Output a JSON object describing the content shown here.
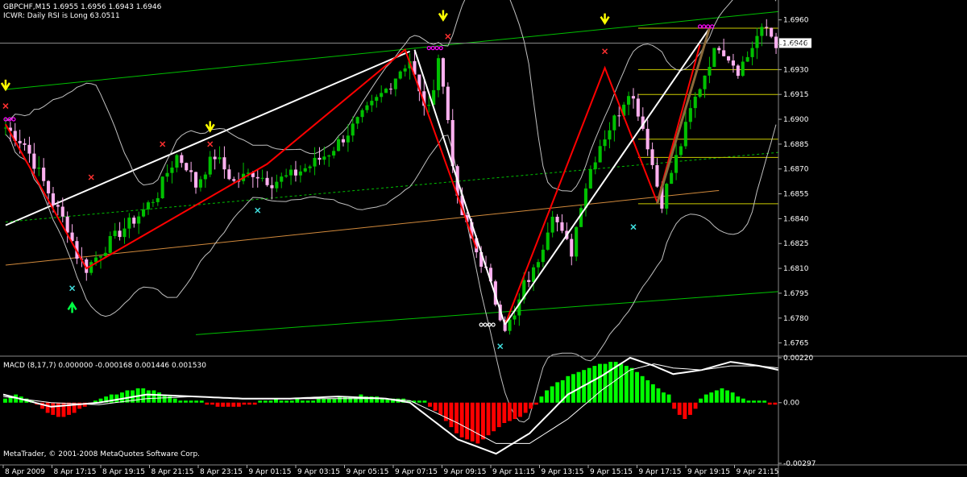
{
  "header": {
    "symbol_line": "GBPCHF,M15  1.6955 1.6956 1.6943 1.6946",
    "indicator_line": "ICWR: Daily RSI is Long 63.0511"
  },
  "macd": {
    "label": "MACD  (8,17,7) 0.000000 -0.000168 0.001446 0.001530"
  },
  "footer": {
    "copyright": "MetaTrader, © 2001-2008 MetaQuotes Software Corp."
  },
  "price_box": "1.6946",
  "colors": {
    "background": "#000000",
    "bull_candle": "#00c000",
    "bear_candle": "#ffb0f0",
    "zigzag": "#ff0000",
    "channel_white": "#ffffff",
    "channel_green": "#00c000",
    "ema": "#d28a3c",
    "fib": "#cccc00",
    "bollinger": "#c0c0c0",
    "macd_pos": "#00ff00",
    "macd_neg": "#ff0000"
  },
  "chart_data": [
    {
      "type": "candlestick",
      "symbol": "GBPCHF",
      "timeframe": "M15",
      "ylim": [
        1.6758,
        1.6972
      ],
      "yticks": [
        "1.6960",
        "1.6945",
        "1.6930",
        "1.6915",
        "1.6900",
        "1.6885",
        "1.6870",
        "1.6855",
        "1.6840",
        "1.6825",
        "1.6810",
        "1.6795",
        "1.6780",
        "1.6765"
      ],
      "xticks": [
        "8 Apr 2009",
        "8 Apr 17:15",
        "8 Apr 19:15",
        "8 Apr 21:15",
        "8 Apr 23:15",
        "9 Apr 01:15",
        "9 Apr 03:15",
        "9 Apr 05:15",
        "9 Apr 07:15",
        "9 Apr 09:15",
        "9 Apr 11:15",
        "9 Apr 13:15",
        "9 Apr 15:15",
        "9 Apr 17:15",
        "9 Apr 19:15",
        "9 Apr 21:15"
      ],
      "close_path": [
        [
          0,
          1.6895
        ],
        [
          4,
          1.6885
        ],
        [
          8,
          1.6862
        ],
        [
          10,
          1.685
        ],
        [
          13,
          1.6835
        ],
        [
          15,
          1.6818
        ],
        [
          17,
          1.681
        ],
        [
          20,
          1.682
        ],
        [
          24,
          1.6832
        ],
        [
          28,
          1.6842
        ],
        [
          32,
          1.6855
        ],
        [
          34,
          1.6868
        ],
        [
          36,
          1.6878
        ],
        [
          38,
          1.6872
        ],
        [
          40,
          1.686
        ],
        [
          42,
          1.687
        ],
        [
          44,
          1.6878
        ],
        [
          46,
          1.687
        ],
        [
          48,
          1.6862
        ],
        [
          52,
          1.6868
        ],
        [
          56,
          1.6862
        ],
        [
          60,
          1.6866
        ],
        [
          64,
          1.6872
        ],
        [
          68,
          1.688
        ],
        [
          72,
          1.6892
        ],
        [
          76,
          1.6905
        ],
        [
          80,
          1.6918
        ],
        [
          83,
          1.693
        ],
        [
          85,
          1.6936
        ],
        [
          87,
          1.6915
        ],
        [
          89,
          1.6905
        ],
        [
          91,
          1.6938
        ],
        [
          93,
          1.69
        ],
        [
          95,
          1.685
        ],
        [
          97,
          1.6835
        ],
        [
          99,
          1.682
        ],
        [
          101,
          1.6808
        ],
        [
          103,
          1.679
        ],
        [
          105,
          1.6775
        ],
        [
          107,
          1.678
        ],
        [
          109,
          1.68
        ],
        [
          111,
          1.6808
        ],
        [
          113,
          1.6825
        ],
        [
          115,
          1.6845
        ],
        [
          117,
          1.683
        ],
        [
          119,
          1.682
        ],
        [
          121,
          1.685
        ],
        [
          123,
          1.687
        ],
        [
          125,
          1.6885
        ],
        [
          127,
          1.6895
        ],
        [
          129,
          1.6905
        ],
        [
          131,
          1.6918
        ],
        [
          133,
          1.6905
        ],
        [
          135,
          1.6885
        ],
        [
          137,
          1.686
        ],
        [
          138,
          1.685
        ],
        [
          140,
          1.6868
        ],
        [
          142,
          1.6885
        ],
        [
          144,
          1.6905
        ],
        [
          146,
          1.692
        ],
        [
          148,
          1.6935
        ],
        [
          150,
          1.6945
        ],
        [
          152,
          1.6938
        ],
        [
          154,
          1.693
        ],
        [
          156,
          1.6938
        ],
        [
          158,
          1.695
        ],
        [
          160,
          1.6955
        ],
        [
          162,
          1.6946
        ]
      ],
      "zigzag": [
        [
          0,
          1.6895
        ],
        [
          17,
          1.681
        ],
        [
          55,
          1.687
        ],
        [
          83,
          1.6941
        ],
        [
          138,
          1.685
        ],
        [
          127,
          1.6931
        ]
      ],
      "annotations": [
        "buy arrow",
        "sell arrows",
        "swing markers"
      ]
    },
    {
      "type": "bar",
      "title": "MACD",
      "params": "(8,17,7)",
      "yticks": [
        "0.00220",
        "0.00",
        "-0.00297"
      ],
      "ylim": [
        -0.00297,
        0.0022
      ],
      "histogram": [
        0.0002,
        0.0003,
        0.0004,
        0.0003,
        0.0002,
        0.0001,
        -0.0001,
        -0.0003,
        -0.0005,
        -0.0006,
        -0.0007,
        -0.0007,
        -0.0006,
        -0.0005,
        -0.0003,
        -0.0002,
        -0.0001,
        0.0001,
        0.0002,
        0.0003,
        0.0004,
        0.0004,
        0.0005,
        0.0006,
        0.0006,
        0.0007,
        0.0007,
        0.0006,
        0.0006,
        0.0005,
        0.0004,
        0.0003,
        0.0002,
        0.0001,
        0.0001,
        0.0001,
        0.0001,
        0.0001,
        -0.0001,
        -0.0001,
        -0.0002,
        -0.0002,
        -0.0002,
        -0.0002,
        -0.0002,
        -0.0001,
        -0.0001,
        -0.0001,
        0.0001,
        0.0001,
        0.0001,
        0.0002,
        0.0001,
        0.0001,
        0.0001,
        0.0002,
        0.0001,
        0.0001,
        0.0001,
        0.0002,
        0.0002,
        0.0002,
        0.0002,
        0.0003,
        0.0003,
        0.0003,
        0.0003,
        0.0004,
        0.0003,
        0.0003,
        0.0003,
        0.0002,
        0.0002,
        0.0002,
        0.0002,
        0.0002,
        0.0001,
        0.0001,
        0.0001,
        0.0001,
        -0.0002,
        -0.0004,
        -0.0006,
        -0.0009,
        -0.0012,
        -0.0015,
        -0.0017,
        -0.0018,
        -0.0019,
        -0.002,
        -0.0018,
        -0.0016,
        -0.0014,
        -0.0012,
        -0.001,
        -0.0009,
        -0.0008,
        -0.0007,
        -0.0005,
        -0.0003,
        -0.0001,
        0.0003,
        0.0006,
        0.0008,
        0.001,
        0.0011,
        0.0013,
        0.0014,
        0.0015,
        0.0016,
        0.0017,
        0.0018,
        0.0019,
        0.0019,
        0.002,
        0.002,
        0.0019,
        0.0018,
        0.0017,
        0.0015,
        0.0013,
        0.0011,
        0.0009,
        0.0007,
        0.0005,
        0.0004,
        -0.0003,
        -0.0006,
        -0.0008,
        -0.0006,
        -0.0003,
        0.0002,
        0.0004,
        0.0005,
        0.0006,
        0.0007,
        0.0006,
        0.0005,
        0.0003,
        0.0002,
        0.0001,
        0.0001,
        0.0001,
        0.0001,
        -0.0001,
        -0.0001
      ],
      "macd_line_path": [
        [
          0,
          0.0004
        ],
        [
          10,
          -0.0002
        ],
        [
          20,
          0.0
        ],
        [
          30,
          0.0004
        ],
        [
          40,
          0.0003
        ],
        [
          50,
          0.0002
        ],
        [
          60,
          0.0002
        ],
        [
          70,
          0.0003
        ],
        [
          80,
          0.0002
        ],
        [
          85,
          0.0
        ],
        [
          95,
          -0.0018
        ],
        [
          103,
          -0.0025
        ],
        [
          110,
          -0.0015
        ],
        [
          118,
          0.0004
        ],
        [
          125,
          0.0013
        ],
        [
          131,
          0.0022
        ],
        [
          136,
          0.0018
        ],
        [
          140,
          0.0014
        ],
        [
          146,
          0.0016
        ],
        [
          152,
          0.002
        ],
        [
          158,
          0.0018
        ],
        [
          162,
          0.0016
        ]
      ],
      "signal_line_path": [
        [
          0,
          0.0003
        ],
        [
          10,
          0.0
        ],
        [
          20,
          -0.0001
        ],
        [
          30,
          0.0002
        ],
        [
          40,
          0.0003
        ],
        [
          50,
          0.0002
        ],
        [
          60,
          0.0002
        ],
        [
          70,
          0.0002
        ],
        [
          80,
          0.0002
        ],
        [
          85,
          0.0001
        ],
        [
          95,
          -0.001
        ],
        [
          103,
          -0.002
        ],
        [
          110,
          -0.002
        ],
        [
          118,
          -0.0008
        ],
        [
          125,
          0.0006
        ],
        [
          131,
          0.0016
        ],
        [
          136,
          0.0019
        ],
        [
          140,
          0.0017
        ],
        [
          146,
          0.0016
        ],
        [
          152,
          0.0018
        ],
        [
          158,
          0.0018
        ],
        [
          162,
          0.0017
        ]
      ]
    }
  ]
}
